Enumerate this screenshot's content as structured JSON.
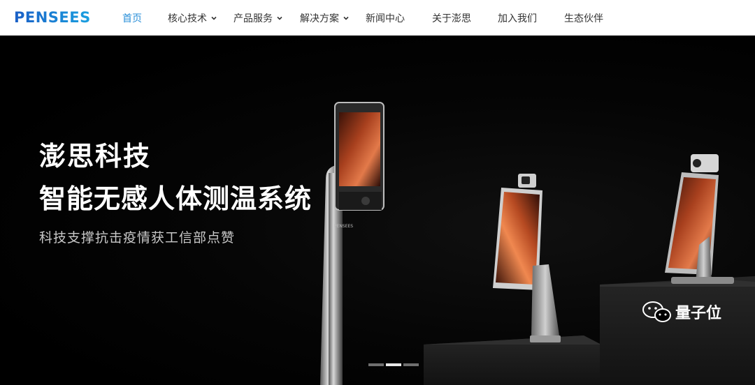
{
  "header": {
    "logo_text": "PENSEES",
    "nav": [
      {
        "label": "首页",
        "active": true,
        "has_dropdown": false
      },
      {
        "label": "核心技术",
        "active": false,
        "has_dropdown": true
      },
      {
        "label": "产品服务",
        "active": false,
        "has_dropdown": true
      },
      {
        "label": "解决方案",
        "active": false,
        "has_dropdown": true
      },
      {
        "label": "新闻中心",
        "active": false,
        "has_dropdown": false
      },
      {
        "label": "关于澎思",
        "active": false,
        "has_dropdown": false
      },
      {
        "label": "加入我们",
        "active": false,
        "has_dropdown": false
      },
      {
        "label": "生态伙伴",
        "active": false,
        "has_dropdown": false
      }
    ]
  },
  "hero": {
    "title": "澎思科技",
    "subtitle": "智能无感人体测温系统",
    "description": "科技支撑抗击疫情获工信部点赞",
    "device_brand": "PENSEES",
    "carousel": {
      "slides": 3,
      "active_index": 1
    }
  },
  "watermark": {
    "text": "量子位",
    "icon": "wechat-icon"
  },
  "colors": {
    "nav_active": "#2a8fd8",
    "nav_text": "#333333",
    "logo": "#1a6fd0",
    "hero_bg": "#000000"
  }
}
